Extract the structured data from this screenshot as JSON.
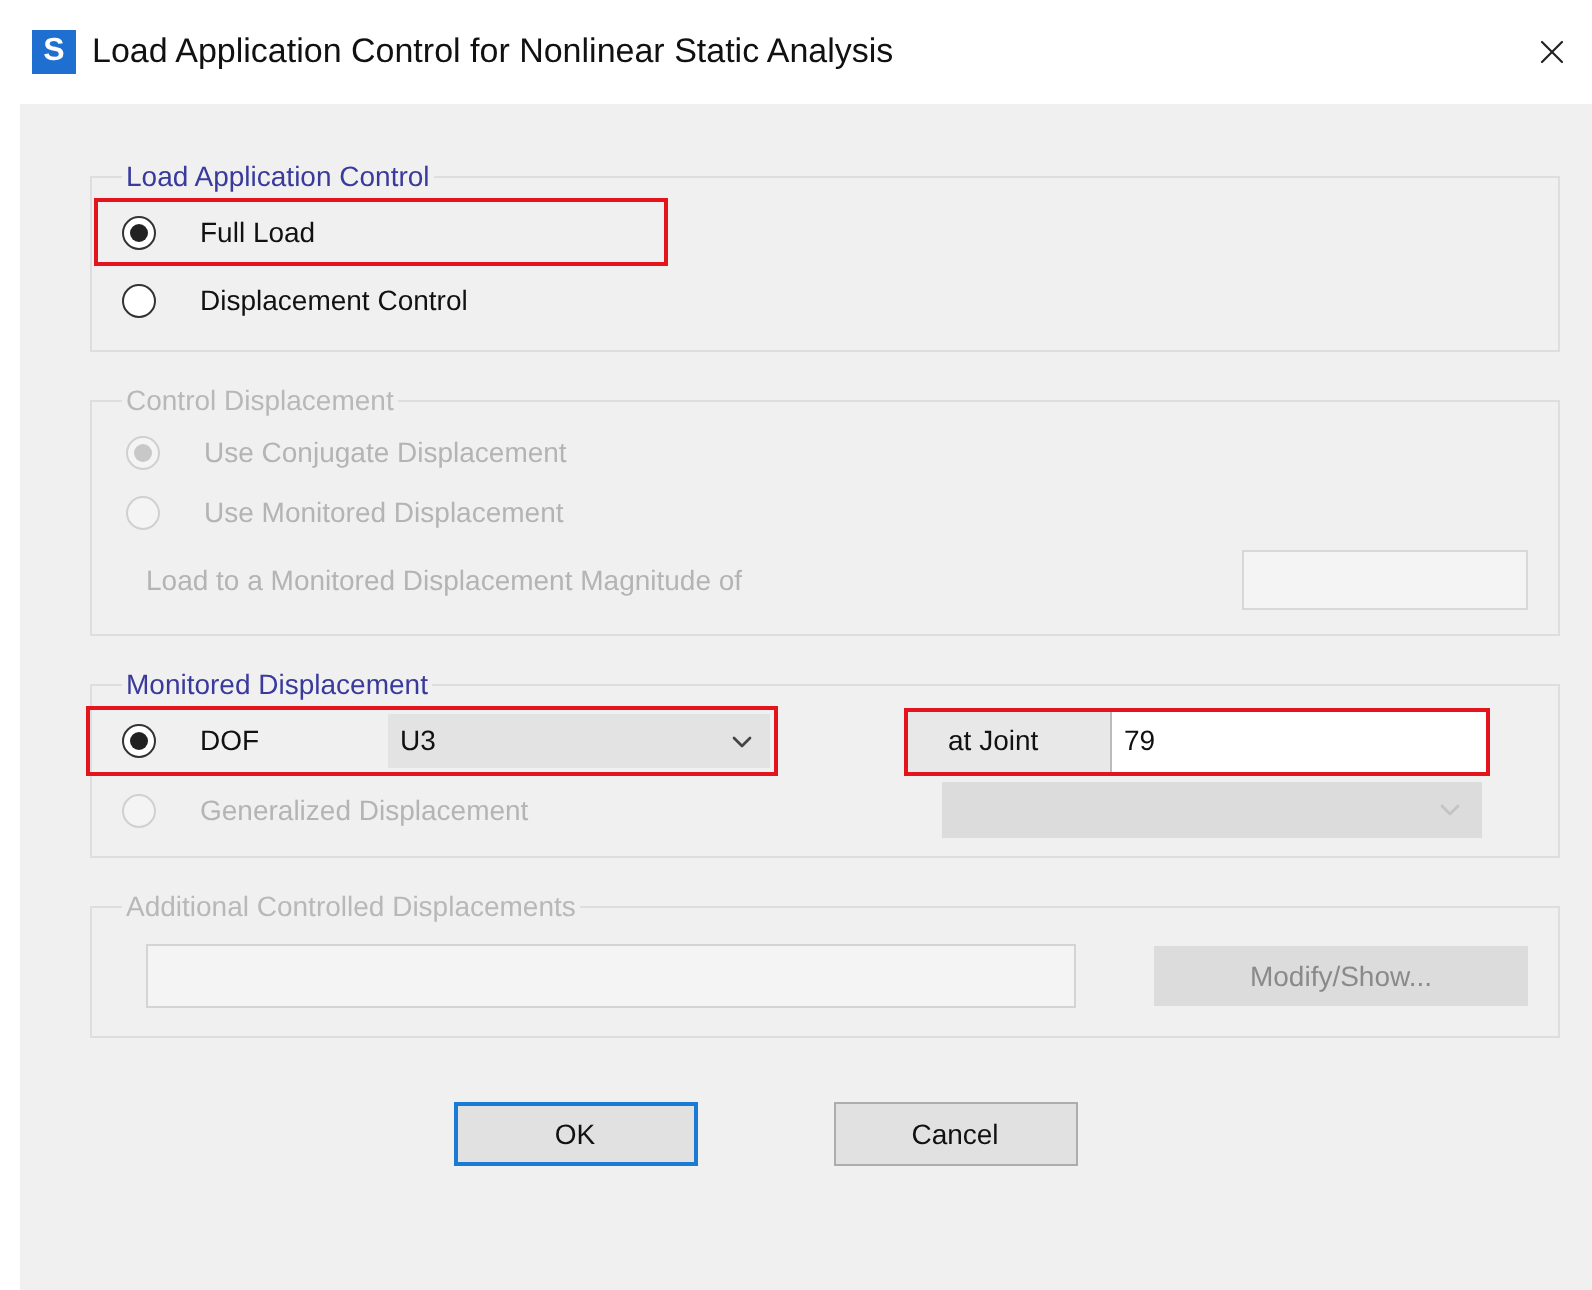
{
  "window": {
    "app_icon": "S",
    "title": "Load Application Control for Nonlinear Static Analysis"
  },
  "load_application_control": {
    "title": "Load Application Control",
    "disabled": false,
    "options": [
      {
        "label": "Full Load",
        "selected": true,
        "highlighted": true
      },
      {
        "label": "Displacement Control",
        "selected": false,
        "highlighted": false
      }
    ]
  },
  "control_displacement": {
    "title": "Control Displacement",
    "disabled": true,
    "options": [
      {
        "label": "Use Conjugate Displacement",
        "selected": true
      },
      {
        "label": "Use Monitored Displacement",
        "selected": false
      }
    ],
    "magnitude_label": "Load to a Monitored Displacement Magnitude of"
  },
  "monitored_displacement": {
    "title": "Monitored Displacement",
    "dof": {
      "label": "DOF",
      "selected": true,
      "disabled": false,
      "value": "U3",
      "highlighted": true
    },
    "joint": {
      "label": "at Joint",
      "value": "79",
      "highlighted": true
    },
    "generalized": {
      "label": "Generalized Displacement",
      "selected": false,
      "disabled": true
    }
  },
  "additional": {
    "title": "Additional Controlled Displacements",
    "disabled": true,
    "button": "Modify/Show..."
  },
  "buttons": [
    {
      "label": "OK",
      "default": true
    },
    {
      "label": "Cancel",
      "default": false
    }
  ]
}
